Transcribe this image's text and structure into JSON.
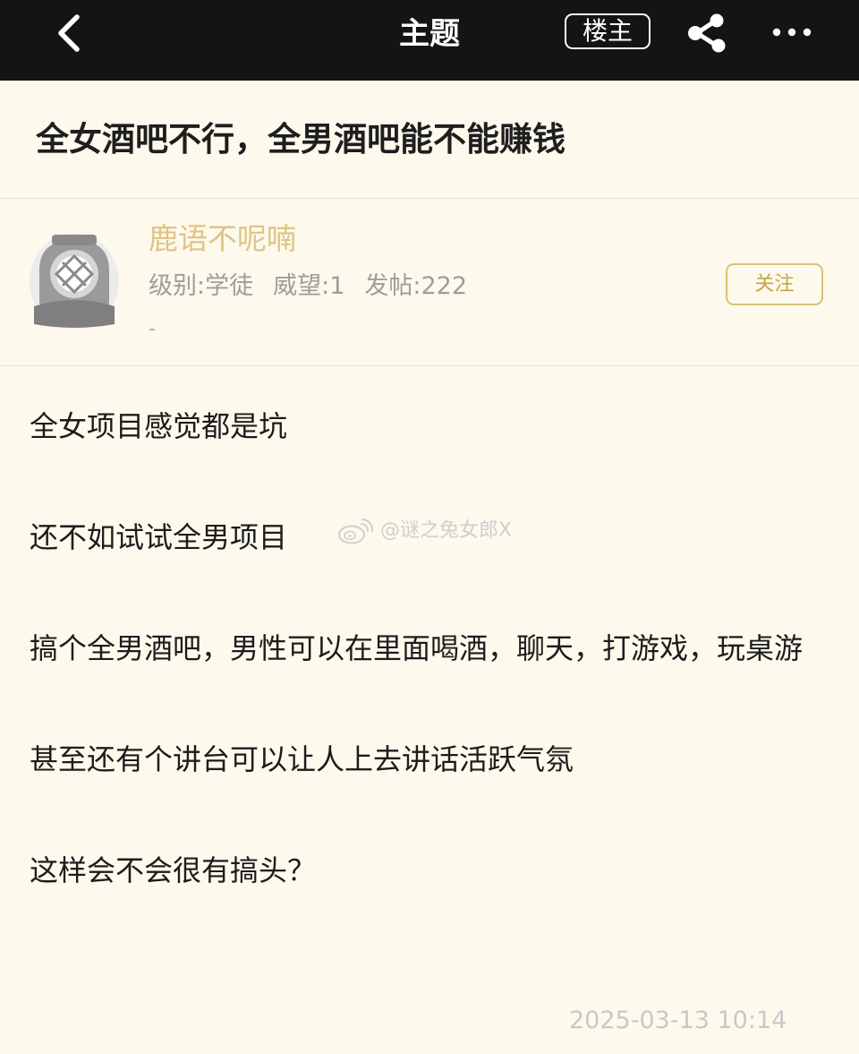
{
  "header": {
    "title": "主题",
    "op_label": "楼主",
    "back_icon": "chevron-left-icon",
    "share_icon": "share-icon",
    "more_icon": "more-horizontal-icon"
  },
  "post": {
    "title": "全女酒吧不行，全男酒吧能不能赚钱",
    "paragraphs": [
      "全女项目感觉都是坑",
      "还不如试试全男项目",
      "搞个全男酒吧，男性可以在里面喝酒，聊天，打游戏，玩桌游",
      "甚至还有个讲台可以让人上去讲话活跃气氛",
      "这样会不会很有搞头？"
    ],
    "timestamp": "2025-03-13 10:14"
  },
  "author": {
    "name": "鹿语不呢喃",
    "level": "级别:学徒",
    "reputation": "威望:1",
    "posts": "发帖:222",
    "signature": "-",
    "follow_label": "关注",
    "avatar_icon": "diving-helmet-avatar"
  },
  "watermark": {
    "text": "@谜之兔女郎X",
    "icon": "weibo-icon"
  },
  "colors": {
    "topbar": "#141414",
    "page_background": "#fdf9ec",
    "username": "#e0c486",
    "follow_border": "#d9c178"
  }
}
